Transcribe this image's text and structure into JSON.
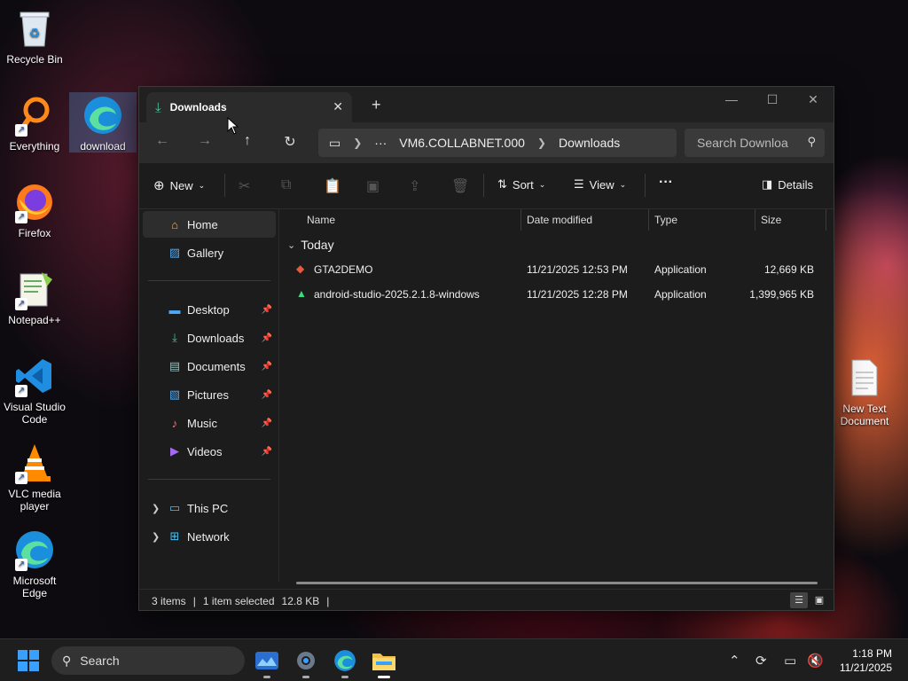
{
  "desktop": {
    "icons": [
      {
        "label": "Recycle Bin"
      },
      {
        "label": "Everything"
      },
      {
        "label": "download"
      },
      {
        "label": "Firefox"
      },
      {
        "label": "Notepad++"
      },
      {
        "label": "Visual Studio Code"
      },
      {
        "label": "VLC media player"
      },
      {
        "label": "Microsoft Edge"
      },
      {
        "label": "New Text Document"
      }
    ]
  },
  "window": {
    "tab_title": "Downloads",
    "address": {
      "crumbs": [
        "VM6.COLLABNET.000",
        "Downloads"
      ],
      "overflow": "···"
    },
    "search_placeholder": "Search Downloa",
    "commands": {
      "new_label": "New",
      "sort_label": "Sort",
      "view_label": "View",
      "more_label": "···",
      "details_label": "Details"
    },
    "sidebar": {
      "top": [
        {
          "label": "Home"
        },
        {
          "label": "Gallery"
        }
      ],
      "pinned": [
        {
          "label": "Desktop"
        },
        {
          "label": "Downloads"
        },
        {
          "label": "Documents"
        },
        {
          "label": "Pictures"
        },
        {
          "label": "Music"
        },
        {
          "label": "Videos"
        }
      ],
      "tree": [
        {
          "label": "This PC"
        },
        {
          "label": "Network"
        }
      ]
    },
    "columns": [
      "Name",
      "Date modified",
      "Type",
      "Size"
    ],
    "group_label": "Today",
    "files": [
      {
        "name": "GTA2DEMO",
        "date": "11/21/2025 12:53 PM",
        "type": "Application",
        "size": "12,669 KB"
      },
      {
        "name": "android-studio-2025.2.1.8-windows",
        "date": "11/21/2025 12:28 PM",
        "type": "Application",
        "size": "1,399,965 KB"
      }
    ],
    "status": {
      "items": "3 items",
      "selected": "1 item selected",
      "selected_size": "12.8 KB"
    }
  },
  "taskbar": {
    "search_label": "Search",
    "time": "1:18 PM",
    "date": "11/21/2025"
  },
  "colors": {
    "accent": "#3aa0ff",
    "window_bg": "#1c1c1c",
    "taskbar_bg": "#1e1e1e"
  }
}
